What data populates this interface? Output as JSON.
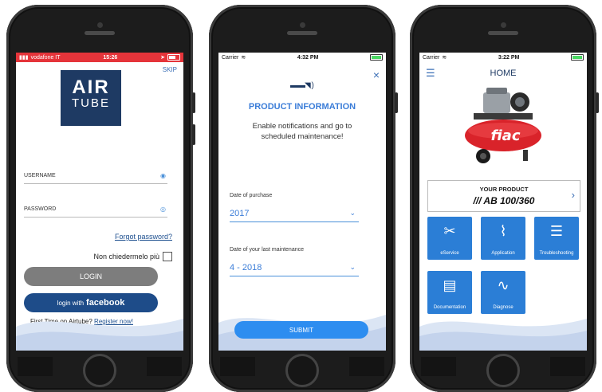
{
  "screen1": {
    "status": {
      "carrier": "vodafone IT",
      "time": "15:26"
    },
    "skip": "SKIP",
    "logo": {
      "line1": "AIR",
      "line2": "TUBE"
    },
    "username_label": "USERNAME",
    "password_label": "PASSWORD",
    "forgot": "Forgot password?",
    "remember": "Non chiedermelo più",
    "login_btn": "LOGIN",
    "fb_prefix": "login with",
    "fb_brand": "facebook",
    "first_time": "First Time on Airtube?",
    "register": "Register now!"
  },
  "screen2": {
    "status": {
      "carrier": "Carrier",
      "time": "4:32 PM"
    },
    "close": "×",
    "title": "PRODUCT INFORMATION",
    "text": "Enable notifications and go to scheduled maintenance!",
    "purchase_label": "Date of purchase",
    "purchase_value": "2017",
    "maint_label": "Date of your last maintenance",
    "maint_value": "4 - 2018",
    "submit": "SUBMIT"
  },
  "screen3": {
    "status": {
      "carrier": "Carrier",
      "time": "3:22 PM"
    },
    "title": "HOME",
    "product_label": "YOUR PRODUCT",
    "product_name": "/// AB 100/360",
    "brand": "fiac",
    "tiles": [
      {
        "label": "eService"
      },
      {
        "label": "Application"
      },
      {
        "label": "Troubleshooting"
      },
      {
        "label": "Documentation"
      },
      {
        "label": "Diagnose"
      }
    ]
  },
  "colors": {
    "accent": "#2b7ed6",
    "dark_blue": "#1e3a63",
    "red_status": "#e5343a"
  }
}
